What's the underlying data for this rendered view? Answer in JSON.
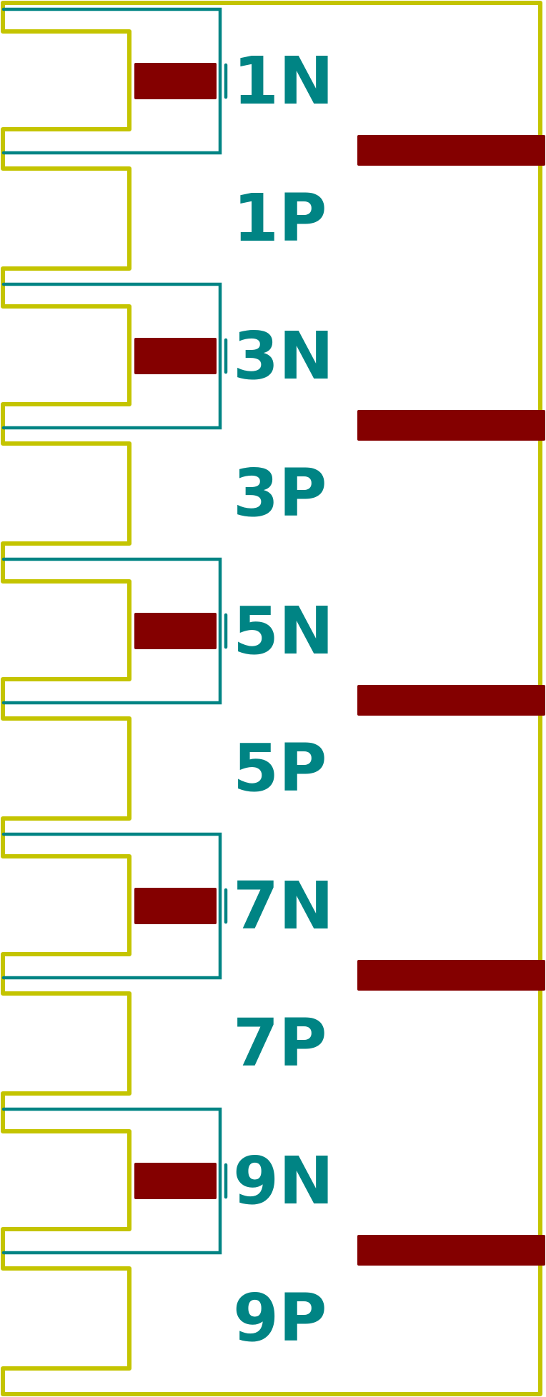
{
  "colors": {
    "outline": "#C4C400",
    "fab": "#008484",
    "pad": "#840000",
    "background": "#FFFFFF"
  },
  "pins": [
    {
      "n_label": "1N",
      "p_label": "1P"
    },
    {
      "n_label": "3N",
      "p_label": "3P"
    },
    {
      "n_label": "5N",
      "p_label": "5P"
    },
    {
      "n_label": "7N",
      "p_label": "7P"
    },
    {
      "n_label": "9N",
      "p_label": "9P"
    }
  ]
}
